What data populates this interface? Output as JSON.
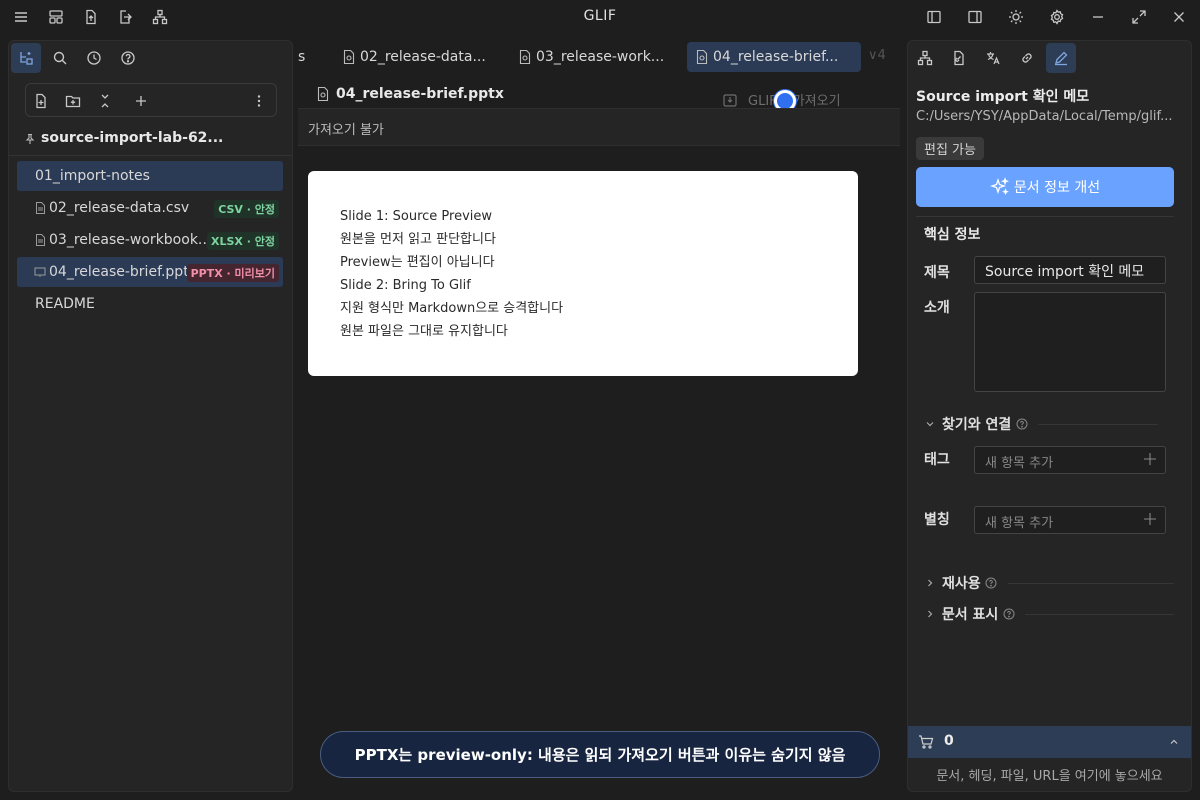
{
  "app": {
    "title": "GLIF"
  },
  "left_panel": {
    "vault_name": "source-import-lab-62...",
    "files": [
      {
        "label": "01_import-notes",
        "badge": ""
      },
      {
        "label": "02_release-data.csv",
        "badge": "CSV · 안정"
      },
      {
        "label": "03_release-workbook.x...",
        "badge": "XLSX · 안정"
      },
      {
        "label": "04_release-brief.pptx",
        "badge": "PPTX · 미리보기"
      },
      {
        "label": "README",
        "badge": ""
      }
    ]
  },
  "tabs": {
    "partial_left": "s",
    "items": [
      {
        "label": "02_release-data..."
      },
      {
        "label": "03_release-work..."
      },
      {
        "label": "04_release-brief..."
      }
    ],
    "overflow": "∨4"
  },
  "document": {
    "title": "04_release-brief.pptx",
    "import_label": "GLIF로 가져오기",
    "status": "가져오기 불가",
    "preview_lines": [
      "Slide 1: Source Preview",
      "원본을 먼저 읽고 판단합니다",
      "Preview는 편집이 아닙니다",
      "Slide 2: Bring To Glif",
      "지원 형식만 Markdown으로 승격합니다",
      "원본 파일은 그대로 유지합니다"
    ]
  },
  "toast": {
    "text": "PPTX는 preview-only: 내용은 읽되 가져오기 버튼과 이유는 숨기지 않음"
  },
  "right_panel": {
    "title": "Source import 확인 메모",
    "path": "C:/Users/YSY/AppData/Local/Temp/glif...",
    "editable_badge": "편집 가능",
    "improve_button": "문서 정보 개선",
    "core_info": "핵심 정보",
    "fields": {
      "title_label": "제목",
      "title_value": "Source import 확인 메모",
      "intro_label": "소개",
      "intro_value": ""
    },
    "find_link": {
      "heading": "찾기와 연결",
      "tag_label": "태그",
      "tag_placeholder": "새 항목 추가",
      "alias_label": "별칭",
      "alias_placeholder": "새 항목 추가"
    },
    "reuse_heading": "재사용",
    "display_heading": "문서 표시",
    "cart": {
      "count": "0",
      "drop_hint": "문서, 헤딩, 파일, URL을 여기에 놓으세요"
    }
  },
  "colors": {
    "accent": "#6aa3ff",
    "selected_bg": "#2b3a55",
    "toast_bg": "#172540"
  }
}
